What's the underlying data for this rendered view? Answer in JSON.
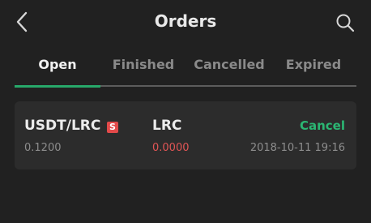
{
  "header": {
    "title": "Orders",
    "back_icon": "chevron-left-icon",
    "search_icon": "search-icon"
  },
  "tabs": [
    {
      "label": "Open",
      "active": true
    },
    {
      "label": "Finished",
      "active": false
    },
    {
      "label": "Cancelled",
      "active": false
    },
    {
      "label": "Expired",
      "active": false
    }
  ],
  "orders": [
    {
      "pair": "USDT/LRC",
      "badge": "S",
      "price": "0.1200",
      "token": "LRC",
      "amount": "0.0000",
      "action": "Cancel",
      "time": "2018-10-11 19:16"
    }
  ],
  "colors": {
    "background": "#212121",
    "card": "#2c2c2c",
    "accent_green": "#2bb673",
    "sell_red": "#e24a4a"
  }
}
